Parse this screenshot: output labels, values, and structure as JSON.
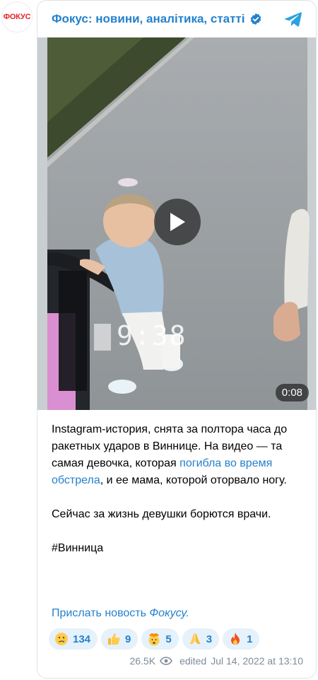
{
  "channel": {
    "avatar_text": "ФОКУС",
    "title": "Фокус: новини, аналітика, статті"
  },
  "video": {
    "duration": "0:08",
    "overlay_time": "9:38"
  },
  "post": {
    "p1_a": "Instagram-история, снята за полтора часа до ракетных ударов в Виннице. На видео — та самая девочка, которая ",
    "p1_link": "погибла во время обстрела",
    "p1_b": ", и ее мама, которой оторвало ногу.",
    "p2": "Сейчас за жизнь девушки борются врачи.",
    "hashtag": "#Винница",
    "promo_a": "Прислать новость ",
    "promo_b": "Фокусу."
  },
  "reactions": [
    {
      "emoji": "crying-face",
      "count": "134"
    },
    {
      "emoji": "thumbs-up",
      "count": "9"
    },
    {
      "emoji": "exploding-head",
      "count": "5"
    },
    {
      "emoji": "folded-hands",
      "count": "3"
    },
    {
      "emoji": "fire",
      "count": "1"
    }
  ],
  "meta": {
    "views": "26.5K",
    "edited": "edited",
    "date": "Jul 14, 2022 at 13:10"
  },
  "colors": {
    "accent": "#2481cc",
    "reaction_bg": "#e5f1fb",
    "meta": "#7d8b99",
    "brand_red": "#e3242b"
  }
}
